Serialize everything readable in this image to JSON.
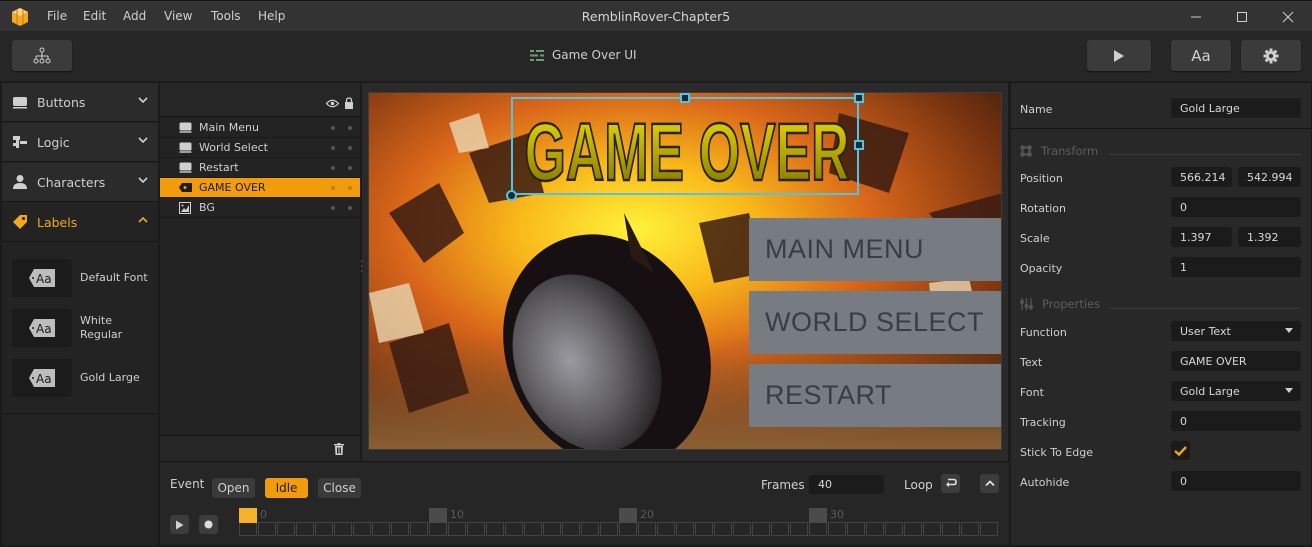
{
  "app": {
    "window_title": "RemblinRover-Chapter5",
    "menu": [
      "File",
      "Edit",
      "Add",
      "View",
      "Tools",
      "Help"
    ]
  },
  "toolbar": {
    "hierarchy_button_icon": "hierarchy-icon",
    "document_title": "Game Over UI",
    "play_button_icon": "play-icon",
    "font_button_label": "Aa",
    "settings_button_icon": "gear-icon"
  },
  "library": {
    "categories": [
      {
        "label": "Buttons",
        "icon": "button-icon",
        "expanded": false
      },
      {
        "label": "Logic",
        "icon": "logic-icon",
        "expanded": false
      },
      {
        "label": "Characters",
        "icon": "person-icon",
        "expanded": false
      },
      {
        "label": "Labels",
        "icon": "tag-icon",
        "expanded": true
      }
    ],
    "label_items": [
      {
        "thumb": "Aa",
        "label": "Default Font"
      },
      {
        "thumb": "Aa",
        "label": "White Regular"
      },
      {
        "thumb": "Aa",
        "label": "Gold Large"
      }
    ]
  },
  "hierarchy": {
    "items": [
      {
        "label": "Main Menu",
        "icon": "button-icon",
        "selected": false
      },
      {
        "label": "World Select",
        "icon": "button-icon",
        "selected": false
      },
      {
        "label": "Restart",
        "icon": "button-icon",
        "selected": false
      },
      {
        "label": "GAME OVER",
        "icon": "label-icon",
        "selected": true
      },
      {
        "label": "BG",
        "icon": "image-icon",
        "selected": false
      }
    ]
  },
  "scene": {
    "title_text": "GAME OVER",
    "buttons": [
      "MAIN MENU",
      "WORLD SELECT",
      "RESTART"
    ],
    "selection_color": "#4fc3e8",
    "accent": "#f29c0b"
  },
  "timeline": {
    "event_label": "Event",
    "events": [
      {
        "label": "Open",
        "active": false
      },
      {
        "label": "Idle",
        "active": true
      },
      {
        "label": "Close",
        "active": false
      }
    ],
    "frames_label": "Frames",
    "frames_value": "40",
    "loop_label": "Loop",
    "frame_count": 40,
    "current_frame": 0,
    "frame_labels": [
      "0",
      "10",
      "20",
      "30"
    ]
  },
  "inspector": {
    "name_label": "Name",
    "name_value": "Gold Large",
    "transform_title": "Transform",
    "position_label": "Position",
    "position_x": "566.214",
    "position_y": "542.994",
    "rotation_label": "Rotation",
    "rotation_value": "0",
    "scale_label": "Scale",
    "scale_x": "1.397",
    "scale_y": "1.392",
    "opacity_label": "Opacity",
    "opacity_value": "1",
    "properties_title": "Properties",
    "function_label": "Function",
    "function_value": "User Text",
    "text_label": "Text",
    "text_value": "GAME OVER",
    "font_label": "Font",
    "font_value": "Gold Large",
    "tracking_label": "Tracking",
    "tracking_value": "0",
    "stick_label": "Stick To Edge",
    "stick_checked": true,
    "autohide_label": "Autohide",
    "autohide_value": "0"
  }
}
